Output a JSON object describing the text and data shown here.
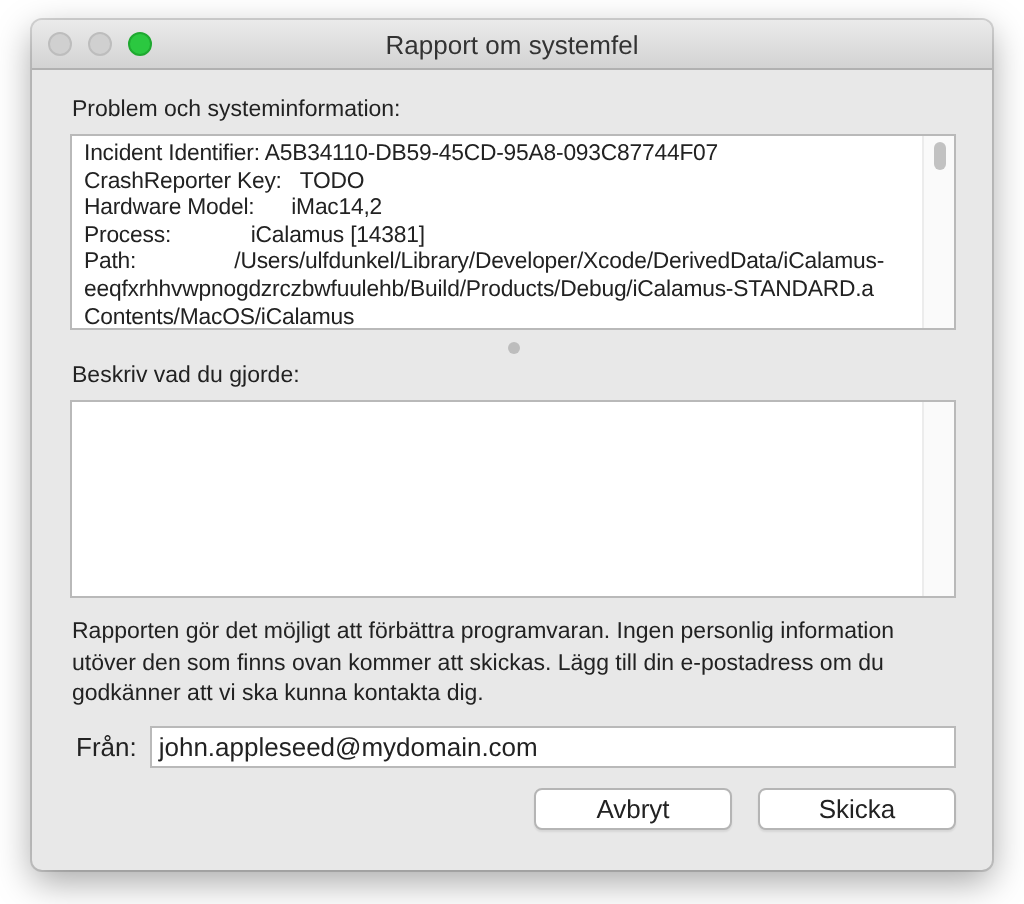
{
  "window": {
    "title": "Rapport om systemfel"
  },
  "problem_section": {
    "label": "Problem och systeminformation:",
    "lines": [
      "Incident Identifier: A5B34110-DB59-45CD-95A8-093C87744F07",
      "CrashReporter Key:   TODO",
      "Hardware Model:      iMac14,2",
      "Process:             iCalamus [14381]",
      "Path:                /Users/ulfdunkel/Library/Developer/Xcode/DerivedData/iCalamus-",
      "eeqfxrhhvwpnogdzrczbwfuulehb/Build/Products/Debug/iCalamus-STANDARD.a",
      "Contents/MacOS/iCalamus"
    ]
  },
  "description_section": {
    "label": "Beskriv vad du gjorde:"
  },
  "notice": "Rapporten gör det möjligt att förbättra programvaran. Ingen personlig information utöver den som finns ovan kommer att skickas. Lägg till din e-postadress om du godkänner att vi ska kunna kontakta dig.",
  "from_field": {
    "label": "Från:",
    "value": "john.appleseed@mydomain.com"
  },
  "buttons": [
    "Avbryt",
    "Skicka"
  ]
}
